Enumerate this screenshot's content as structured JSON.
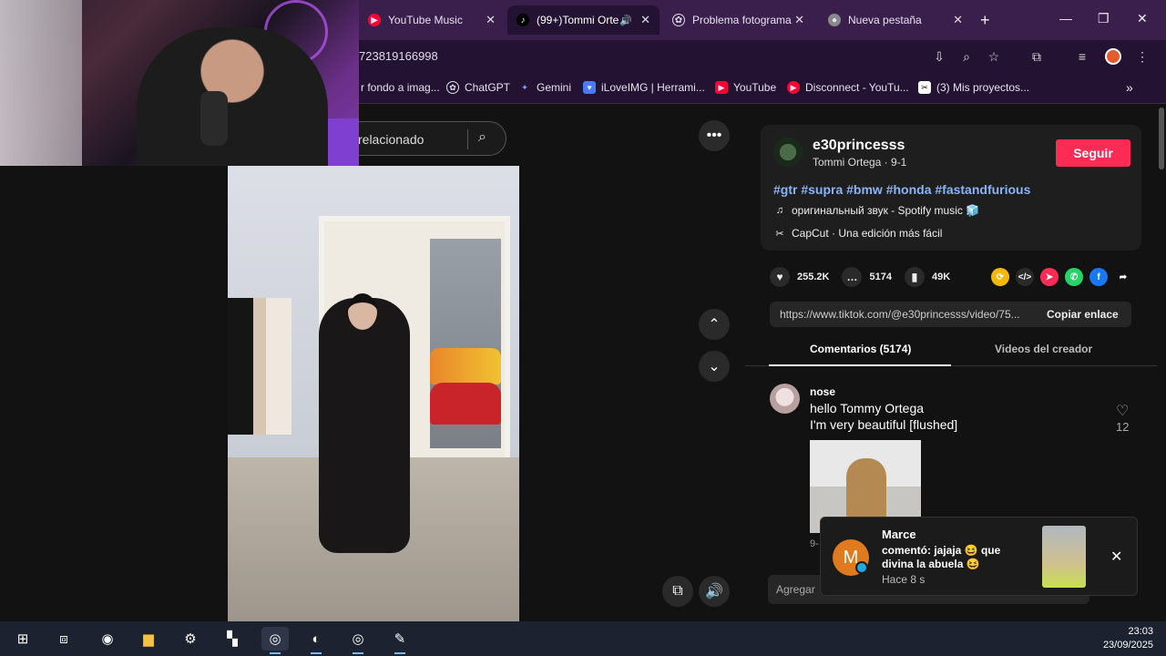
{
  "browser": {
    "tabs": [
      {
        "label": "YouTube Music",
        "icon": "youtube-music-icon"
      },
      {
        "label": "(99+)Tommi Orte",
        "icon": "tiktok-icon",
        "active": true
      },
      {
        "label": "Problema fotograma",
        "icon": "chatgpt-icon"
      },
      {
        "label": "Nueva pestaña",
        "icon": "chrome-icon"
      }
    ],
    "new_tab": "+",
    "url": "723819166998",
    "bookmarks": [
      {
        "label": "r fondo a imag...",
        "icon": "bookmark-icon"
      },
      {
        "label": "ChatGPT",
        "icon": "chatgpt-icon"
      },
      {
        "label": "Gemini",
        "icon": "gemini-icon"
      },
      {
        "label": "iLoveIMG | Herrami...",
        "icon": "ilovimg-icon"
      },
      {
        "label": "YouTube",
        "icon": "youtube-icon"
      },
      {
        "label": "Disconnect - YouTu...",
        "icon": "youtube-icon"
      },
      {
        "label": "(3)  Mis proyectos...",
        "icon": "capcut-icon"
      }
    ]
  },
  "search": {
    "text": "relacionado"
  },
  "author": {
    "username": "e30princesss",
    "nickname": "Tommi Ortega · 9-1",
    "follow_label": "Seguir",
    "hashtags": "#gtr #supra #bmw #honda #fastandfurious",
    "music": "оригинальный звук - Spotify music 🧊",
    "capcut": "CapCut · Una edición más fácil"
  },
  "stats": {
    "likes": "255.2K",
    "comments": "5174",
    "saves": "49K"
  },
  "link": {
    "url": "https://www.tiktok.com/@e30princesss/video/75...",
    "copy_label": "Copiar enlace"
  },
  "tabs": {
    "comments": "Comentarios (5174)",
    "creator": "Videos del creador"
  },
  "comment": {
    "user": "nose",
    "line1": "hello Tommy Ortega",
    "line2": "I'm very beautiful [flushed]",
    "likes": "12",
    "date": "9-"
  },
  "add_comment": {
    "placeholder": "Agregar"
  },
  "notification": {
    "avatar_letter": "M",
    "name": "Marce",
    "message": "comentó: jajaja 😆 que divina la abuela 😆",
    "time": "Hace 8 s"
  },
  "taskbar": {
    "time": "23:03",
    "date": "23/09/2025"
  },
  "colors": {
    "accent": "#fe2c55",
    "hashtag": "#8ab4f8",
    "browser_frame": "#3a1f4d"
  }
}
